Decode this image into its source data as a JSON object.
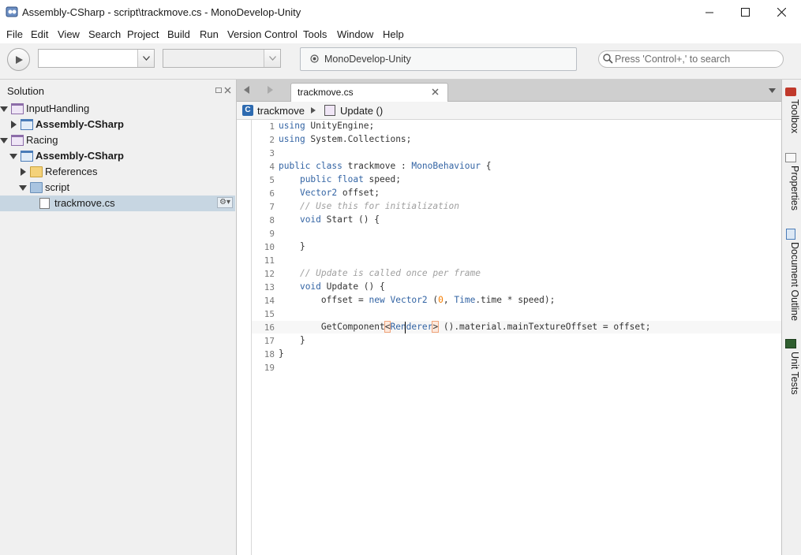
{
  "window": {
    "title": "Assembly-CSharp - script\\trackmove.cs - MonoDevelop-Unity"
  },
  "menu": [
    "File",
    "Edit",
    "View",
    "Search",
    "Project",
    "Build",
    "Run",
    "Version Control",
    "Tools",
    "Window",
    "Help"
  ],
  "toolbar": {
    "status_text": "MonoDevelop-Unity",
    "search_placeholder": "Press 'Control+,' to search"
  },
  "solution": {
    "title": "Solution",
    "items": [
      {
        "label": "InputHandling",
        "bold": false
      },
      {
        "label": "Assembly-CSharp",
        "bold": true
      },
      {
        "label": "Racing",
        "bold": false
      },
      {
        "label": "Assembly-CSharp",
        "bold": true
      },
      {
        "label": "References",
        "bold": false
      },
      {
        "label": "script",
        "bold": false
      },
      {
        "label": "trackmove.cs",
        "bold": false
      }
    ]
  },
  "editor": {
    "tab_label": "trackmove.cs",
    "path_class": "trackmove",
    "path_method": "Update ()",
    "line_numbers": [
      "1",
      "2",
      "3",
      "4",
      "5",
      "6",
      "7",
      "8",
      "9",
      "10",
      "11",
      "12",
      "13",
      "14",
      "15",
      "16",
      "17",
      "18",
      "19"
    ]
  },
  "side_pads": [
    "Toolbox",
    "Properties",
    "Document Outline",
    "Unit Tests"
  ],
  "colors": {
    "keyword": "#3364a4",
    "comment": "#a0a0a0",
    "number": "#f57d00",
    "selection": "#c7d6e2"
  }
}
